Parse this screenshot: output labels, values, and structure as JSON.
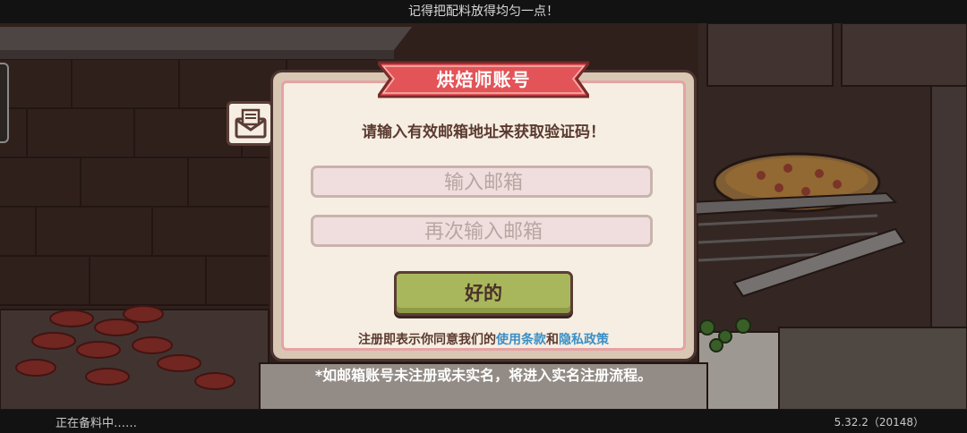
{
  "top_bar": {
    "tip": "记得把配料放得均匀一点！"
  },
  "bottom_bar": {
    "status": "正在备料中……",
    "version": "5.32.2（20148）"
  },
  "dialog": {
    "title": "烘焙师账号",
    "prompt": "请输入有效邮箱地址来获取验证码！",
    "email_input": {
      "placeholder": "输入邮箱",
      "value": ""
    },
    "confirm_email_input": {
      "placeholder": "再次输入邮箱",
      "value": ""
    },
    "ok_button": "好的",
    "terms": {
      "prefix": "注册即表示你同意我们的",
      "terms_link": "使用条款",
      "and": "和",
      "privacy_link": "隐私政策"
    },
    "icon": "mail-icon"
  },
  "footnote": "*如邮箱账号未注册或未实名，将进入实名注册流程。",
  "colors": {
    "ribbon": "#e25458",
    "dialog_border": "#e5a3a4",
    "dialog_bg": "#f6eee2",
    "ok_button": "#a8b75c",
    "link": "#3b8fc6",
    "text": "#5b3a30"
  }
}
